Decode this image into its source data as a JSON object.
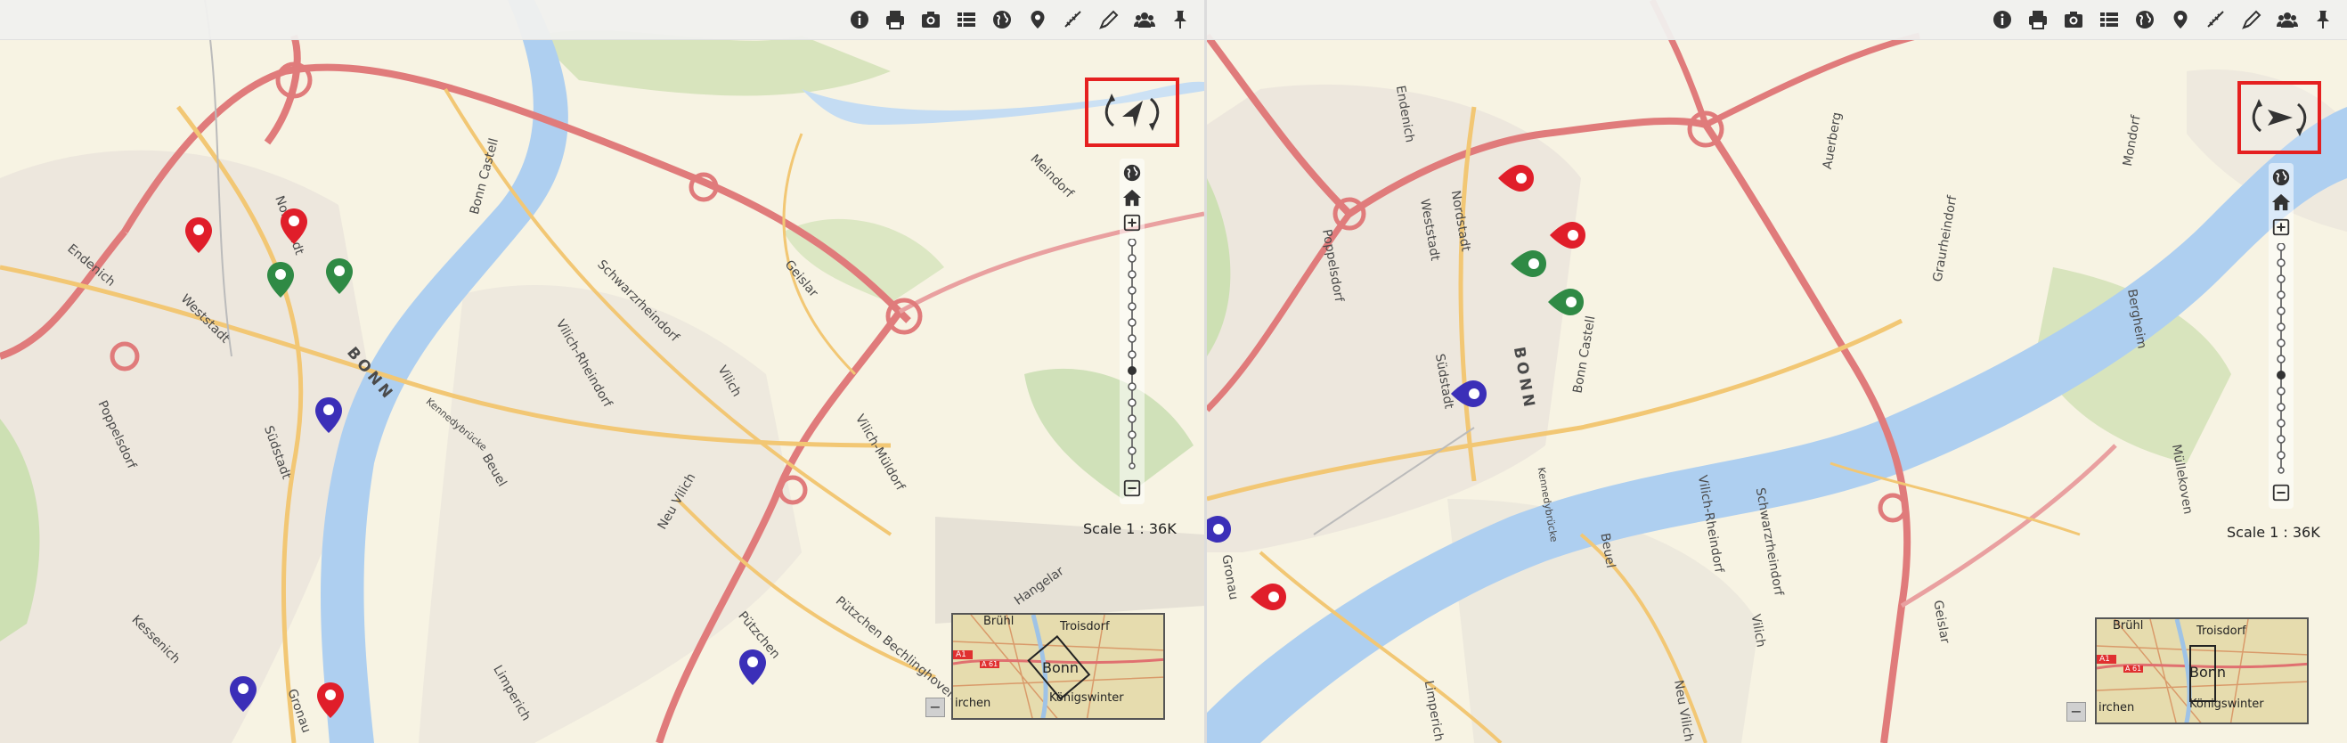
{
  "toolbar": {
    "icons": [
      "info-icon",
      "print-icon",
      "camera-icon",
      "list-icon",
      "globe-icon",
      "location-pin-icon",
      "measure-icon",
      "draw-icon",
      "users-icon",
      "pin-icon"
    ]
  },
  "panes": {
    "left": {
      "scale_label": "Scale 1 : 36K",
      "labels": {
        "endenich": "Endenich",
        "weststadt": "Weststadt",
        "bonn": "BONN",
        "poppelsdorf": "Poppelsdorf",
        "sudstadt": "Südstadt",
        "kessenich": "Kessenich",
        "beuel": "Beuel",
        "vilich": "Vilich",
        "vilich_muldorf": "Vilich-Müldorf",
        "schwarzrheindorf": "Schwarzrheindorf",
        "vilich_rheindorf": "Vilich-Rheindorf",
        "geislar": "Geislar",
        "hangelar": "Hangelar",
        "neu_vilich": "Neu Vilich",
        "limperich": "Limperich",
        "puetzchen": "Pützchen",
        "pützchen_bechlinghoven": "Pützchen Bechlinghoven",
        "meindorf": "Meindorf",
        "nordstadt": "Nordstadt",
        "bonn_castell": "Bonn Castell",
        "gronau": "Gronau",
        "kennedybruecke": "Kennedybrücke"
      },
      "minimap": {
        "bruhl": "Brühl",
        "troisdorf": "Troisdorf",
        "bonn": "Bonn",
        "konigswinter": "Königswinter",
        "kirchen": "irchen",
        "a1": "A1",
        "a61": "A 61"
      }
    },
    "right": {
      "scale_label": "Scale 1 : 36K",
      "labels": {
        "endenich": "Endenich",
        "weststadt": "Weststadt",
        "bonn": "BONN",
        "poppelsdorf": "Poppelsdorf",
        "sudstadt": "Südstadt",
        "beuel": "Beuel",
        "vilich": "Vilich",
        "schwarzrheindorf": "Schwarzrheindorf",
        "vilich_rheindorf": "Vilich-Rheindorf",
        "geislar": "Geislar",
        "graurheindorf": "Graurheindorf",
        "auerberg": "Auerberg",
        "mondorf": "Mondorf",
        "bergheim": "Bergheim",
        "mullekoven": "Müllekoven",
        "limperich": "Limperich",
        "neu_vilich": "Neu Vilich",
        "bonn_castell": "Bonn Castell",
        "gronau": "Gronau",
        "nordstadt": "Nordstadt",
        "kennedybruecke": "Kennedybrücke"
      },
      "minimap": {
        "bruhl": "Brühl",
        "troisdorf": "Troisdorf",
        "bonn": "Bonn",
        "konigswinter": "Königswinter",
        "kirchen": "irchen",
        "a1": "A1",
        "a61": "A 61"
      }
    }
  },
  "colors": {
    "pin_red": "#e01e2a",
    "pin_green": "#2f8a45",
    "pin_blue": "#3b2fb8",
    "river": "#aecff0",
    "highway": "#e07b7b",
    "highlight": "#e52020"
  }
}
